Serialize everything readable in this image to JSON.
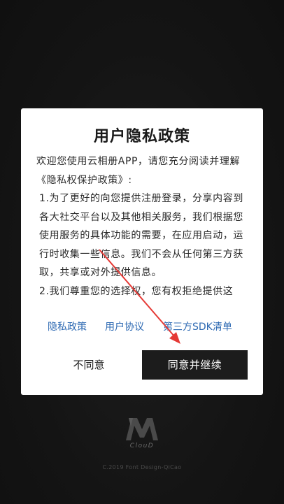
{
  "dialog": {
    "title": "用户隐私政策",
    "paragraphs": [
      "欢迎您使用云相册APP，请您充分阅读并理解《隐私权保护政策》:",
      "1.为了更好的向您提供注册登录，分享内容到各大社交平台以及其他相关服务，我们根据您使用服务的具体功能的需要，在应用启动，运行时收集一些信息。我们不会从任何第三方获取，共享或对外提供信息。",
      "2.我们尊重您的选择权，您有权拒绝提供这"
    ],
    "links": {
      "privacy_policy": "隐私政策",
      "user_agreement": "用户协议",
      "third_party_sdk": "第三方SDK清单"
    },
    "buttons": {
      "decline": "不同意",
      "accept": "同意并继续"
    }
  },
  "background": {
    "logo_text": "ClouD",
    "copyright": "C.2019 Font Design-QiCao"
  },
  "colors": {
    "link": "#2e6ab3",
    "accept_button": "#1c1c1c",
    "annotation_arrow": "#e53935",
    "background": "#151515"
  }
}
